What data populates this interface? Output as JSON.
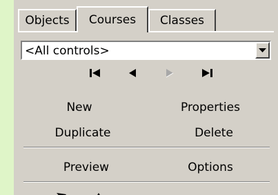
{
  "tabs": [
    {
      "label": "Objects",
      "active": false
    },
    {
      "label": "Courses",
      "active": true
    },
    {
      "label": "Classes",
      "active": false
    }
  ],
  "filter": {
    "value": "<All controls>"
  },
  "nav": [
    {
      "name": "first-record",
      "enabled": true
    },
    {
      "name": "previous-record",
      "enabled": true
    },
    {
      "name": "next-record",
      "enabled": false
    },
    {
      "name": "last-record",
      "enabled": true
    }
  ],
  "actions": {
    "new": "New",
    "properties": "Properties",
    "duplicate": "Duplicate",
    "delete": "Delete",
    "preview": "Preview",
    "options": "Options"
  },
  "colors": {
    "window_bg": "#dff5c8",
    "panel_bg": "#d4d0c8",
    "disabled": "#a8a8a8"
  }
}
